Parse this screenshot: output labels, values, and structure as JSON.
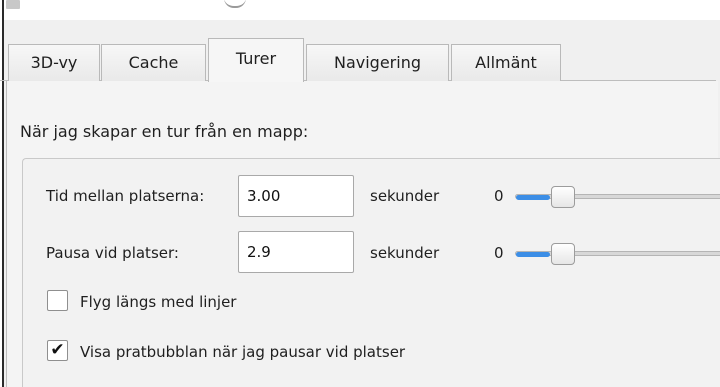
{
  "window": {
    "title_visible": ""
  },
  "tabs": [
    {
      "label": "3D-vy",
      "active": false
    },
    {
      "label": "Cache",
      "active": false
    },
    {
      "label": "Turer",
      "active": true
    },
    {
      "label": "Navigering",
      "active": false
    },
    {
      "label": "Allmänt",
      "active": false
    }
  ],
  "section": {
    "heading": "När jag skapar en tur från en mapp:"
  },
  "settings": {
    "time_between": {
      "label": "Tid mellan platserna:",
      "value": "3.00",
      "unit": "sekunder",
      "slider_min_label": "0",
      "slider_position": 0.0
    },
    "pause_at": {
      "label": "Pausa vid platser:",
      "value": "2.9",
      "unit": "sekunder",
      "slider_min_label": "0",
      "slider_position": 0.0
    }
  },
  "options": {
    "fly_along_lines": {
      "label": "Flyg längs med linjer",
      "checked": false,
      "mark": ""
    },
    "show_balloon": {
      "label": "Visa pratbubblan när jag pausar vid platser",
      "checked": true,
      "mark": "✔"
    }
  },
  "colors": {
    "accent": "#3c8ee6",
    "background": "#f0f0f0"
  }
}
